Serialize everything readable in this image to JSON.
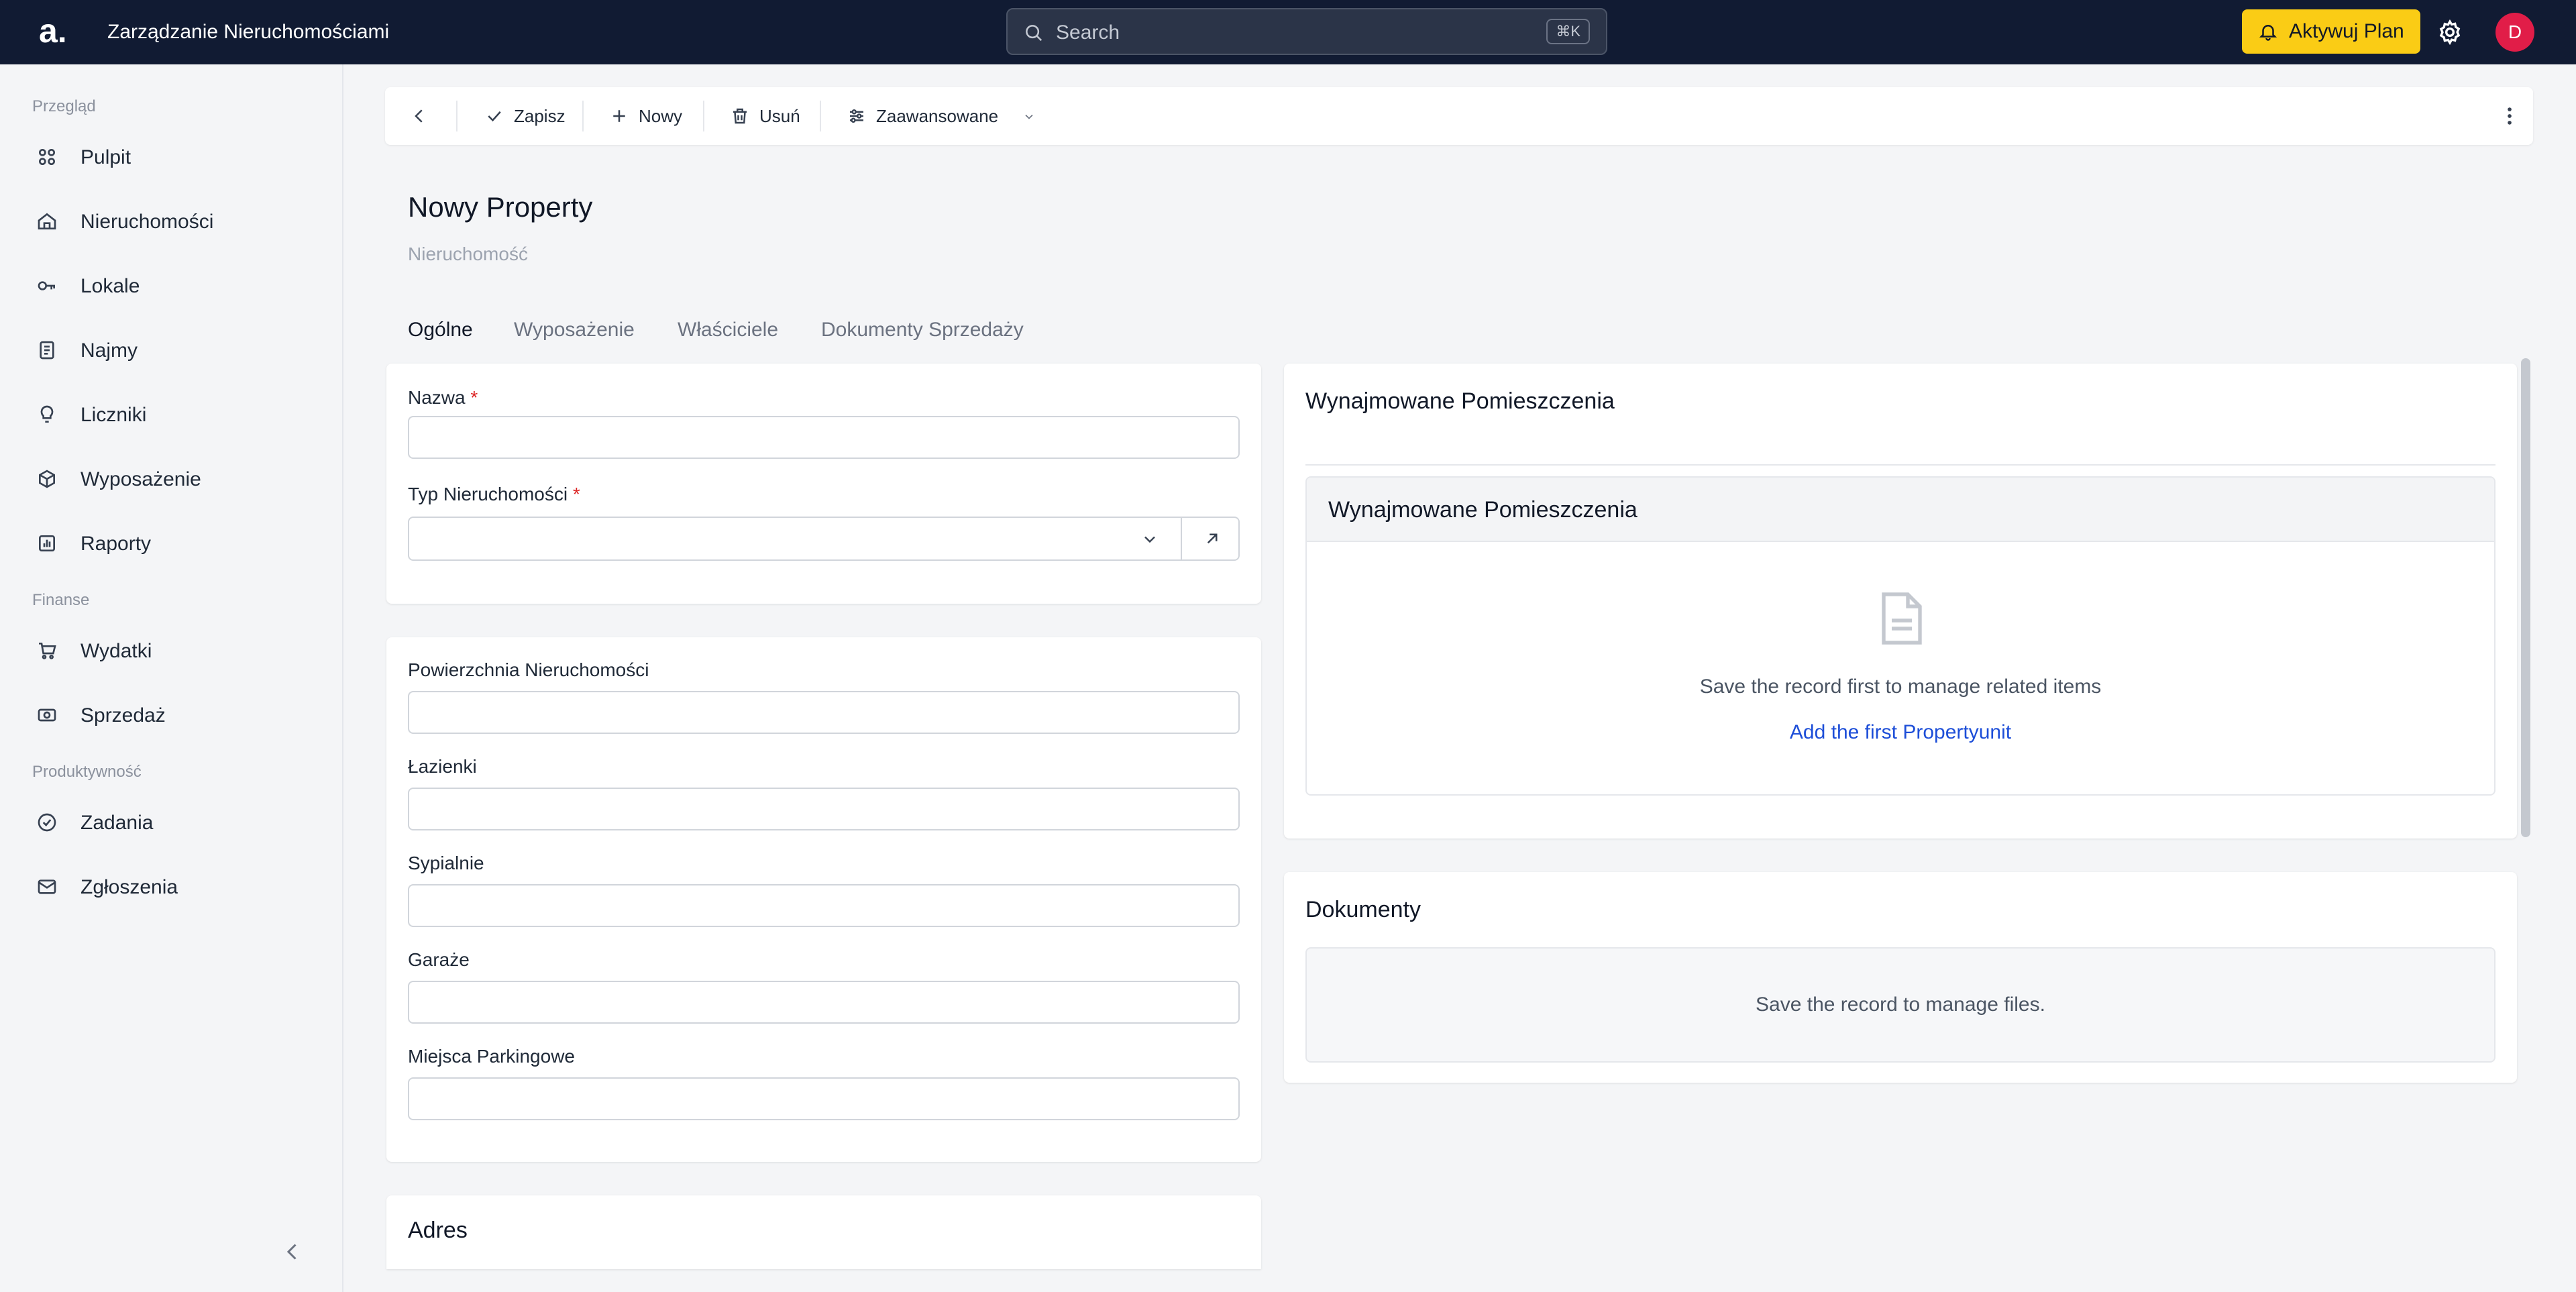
{
  "header": {
    "logo": "a.",
    "app_title": "Zarządzanie Nieruchomościami",
    "search_placeholder": "Search",
    "search_shortcut": "⌘K",
    "upgrade_label": "Aktywuj Plan",
    "avatar_initial": "D",
    "colors": {
      "bar": "#111b33",
      "upgrade": "#facc15",
      "avatar": "#e11d48"
    }
  },
  "sidebar": {
    "sections": [
      {
        "label": "Przegląd",
        "items": [
          {
            "label": "Pulpit",
            "icon": "grid-icon"
          },
          {
            "label": "Nieruchomości",
            "icon": "home-icon"
          },
          {
            "label": "Lokale",
            "icon": "key-icon"
          },
          {
            "label": "Najmy",
            "icon": "document-icon"
          },
          {
            "label": "Liczniki",
            "icon": "bulb-icon"
          },
          {
            "label": "Wyposażenie",
            "icon": "box-icon"
          },
          {
            "label": "Raporty",
            "icon": "chart-icon"
          }
        ]
      },
      {
        "label": "Finanse",
        "items": [
          {
            "label": "Wydatki",
            "icon": "cart-icon"
          },
          {
            "label": "Sprzedaż",
            "icon": "cash-icon"
          }
        ]
      },
      {
        "label": "Produktywność",
        "items": [
          {
            "label": "Zadania",
            "icon": "check-circle-icon"
          },
          {
            "label": "Zgłoszenia",
            "icon": "mail-icon"
          }
        ]
      }
    ]
  },
  "toolbar": {
    "save": "Zapisz",
    "new": "Nowy",
    "delete": "Usuń",
    "advanced": "Zaawansowane"
  },
  "page": {
    "title": "Nowy Property",
    "subtitle": "Nieruchomość"
  },
  "tabs": [
    {
      "label": "Ogólne",
      "active": true
    },
    {
      "label": "Wyposażenie",
      "active": false
    },
    {
      "label": "Właściciele",
      "active": false
    },
    {
      "label": "Dokumenty Sprzedaży",
      "active": false
    }
  ],
  "form": {
    "name": {
      "label": "Nazwa",
      "required": "*",
      "value": ""
    },
    "type": {
      "label": "Typ Nieruchomości",
      "required": "*",
      "value": ""
    },
    "area": {
      "label": "Powierzchnia Nieruchomości",
      "value": ""
    },
    "bathrooms": {
      "label": "Łazienki",
      "value": ""
    },
    "bedrooms": {
      "label": "Sypialnie",
      "value": ""
    },
    "garages": {
      "label": "Garaże",
      "value": ""
    },
    "parking": {
      "label": "Miejsca Parkingowe",
      "value": ""
    },
    "address_heading": "Adres"
  },
  "rented_rooms": {
    "heading": "Wynajmowane Pomieszczenia",
    "panel_title": "Wynajmowane Pomieszczenia",
    "empty_text": "Save the record first to manage related items",
    "add_link": "Add the first Propertyunit"
  },
  "documents": {
    "heading": "Dokumenty",
    "empty_text": "Save the record to manage files."
  }
}
